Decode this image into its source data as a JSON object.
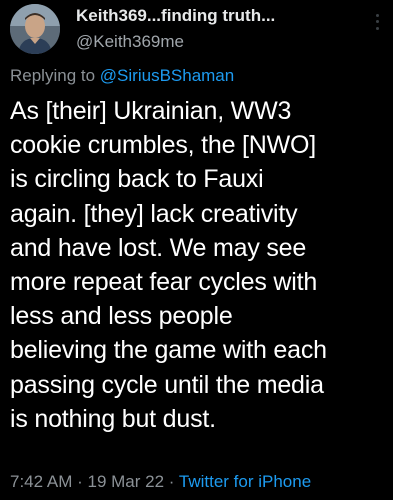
{
  "author": {
    "display_name": "Keith369...finding truth...",
    "handle": "@Keith369me"
  },
  "reply": {
    "prefix": "Replying to",
    "mention": "@SiriusBShaman"
  },
  "tweet": {
    "text": "As [their] Ukrainian, WW3\ncookie crumbles, the [NWO]\nis circling back to Fauxi\nagain.  [they] lack creativity\nand have lost.  We may see\nmore repeat fear cycles with\nless and less people\nbelieving the game with each\npassing cycle until the media\nis nothing but dust."
  },
  "meta": {
    "time": "7:42 AM",
    "date": "19 Mar 22",
    "separator": "·",
    "source": "Twitter for iPhone"
  },
  "colors": {
    "background": "#000000",
    "link": "#1d9bf0",
    "muted": "#8b9196"
  }
}
